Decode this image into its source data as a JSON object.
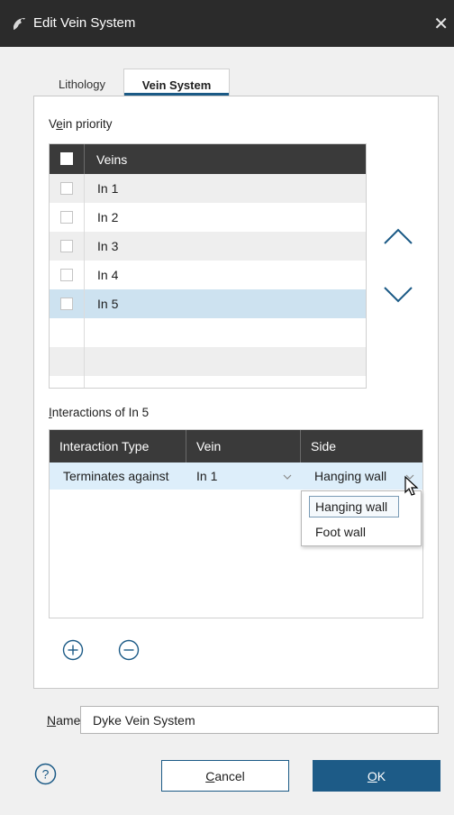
{
  "window": {
    "title": "Edit Vein System",
    "close_glyph": "✕"
  },
  "tabs": [
    {
      "label": "Lithology",
      "active": false
    },
    {
      "label": "Vein System",
      "active": true
    }
  ],
  "vein_priority": {
    "label_prefix": "V",
    "label_underlined": "e",
    "label_suffix": "in priority",
    "column": "Veins",
    "rows": [
      "In 1",
      "In 2",
      "In 3",
      "In 4",
      "In 5"
    ],
    "selected": "In 5"
  },
  "interactions": {
    "label_underlined": "I",
    "label_rest": "nteractions of In 5",
    "columns": [
      "Interaction Type",
      "Vein",
      "Side"
    ],
    "row": {
      "interaction_type": "Terminates against",
      "vein": "In 1",
      "side": "Hanging wall"
    },
    "side_options": [
      "Hanging wall",
      "Foot wall"
    ]
  },
  "name": {
    "label_underlined": "N",
    "label_rest": "ame:",
    "value": "Dyke Vein System"
  },
  "buttons": {
    "cancel_underlined": "C",
    "cancel_rest": "ancel",
    "ok_underlined": "O",
    "ok_rest": "K"
  },
  "icons": {
    "move_up": "chevron-up-icon",
    "move_down": "chevron-down-icon",
    "add": "plus-circle-icon",
    "remove": "minus-circle-icon",
    "help": "help-circle-icon"
  },
  "colors": {
    "accent": "#1d5b87",
    "header": "#3a3a3a",
    "selected_row": "#cde2f0",
    "titlebar": "#2b2b2b"
  }
}
